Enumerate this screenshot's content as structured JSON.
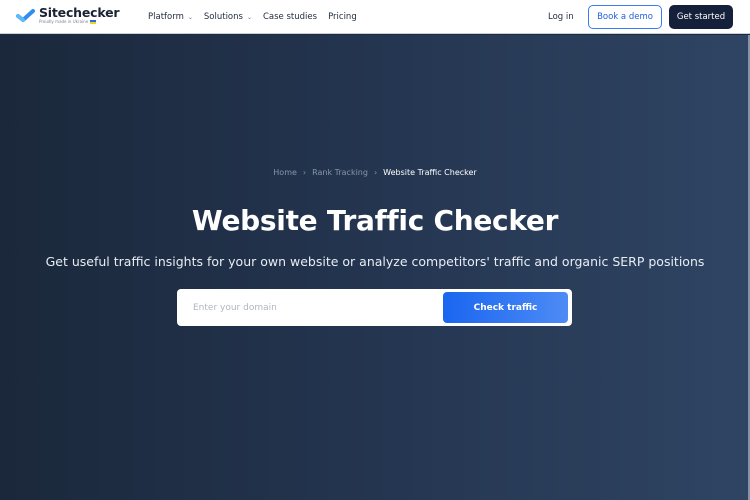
{
  "header": {
    "brand": "Sitechecker",
    "tagline": "Proudly made in Ukraine",
    "nav": [
      {
        "label": "Platform",
        "has_dropdown": true
      },
      {
        "label": "Solutions",
        "has_dropdown": true
      },
      {
        "label": "Case studies",
        "has_dropdown": false
      },
      {
        "label": "Pricing",
        "has_dropdown": false
      }
    ],
    "login_label": "Log in",
    "demo_label": "Book a demo",
    "start_label": "Get started"
  },
  "breadcrumb": {
    "items": [
      "Home",
      "Rank Tracking"
    ],
    "current": "Website Traffic Checker"
  },
  "hero": {
    "title": "Website Traffic Checker",
    "subtitle": "Get useful traffic insights for your own website or analyze competitors' traffic and organic SERP positions"
  },
  "search": {
    "placeholder": "Enter your domain",
    "value": "",
    "button_label": "Check traffic"
  },
  "colors": {
    "accent": "#1a66f0",
    "dark_button": "#15213a",
    "hero_bg_start": "#1b283b",
    "hero_bg_end": "#2f4563"
  },
  "icons": {
    "chevron": "chevron-down-icon",
    "separator": "chevron-right-icon"
  }
}
